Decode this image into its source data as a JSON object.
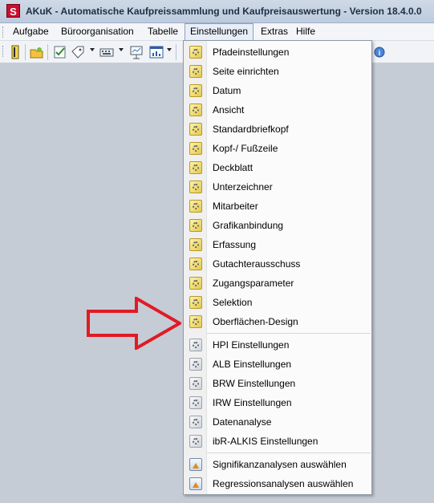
{
  "window": {
    "app_icon_letter": "S",
    "title": "AKuK - Automatische Kaufpreissammlung und Kaufpreisauswertung - Version 18.4.0.0"
  },
  "menubar": {
    "items": [
      {
        "label": "Aufgabe",
        "mnemonic": "A"
      },
      {
        "label": "Büroorganisation",
        "mnemonic": "B"
      },
      {
        "label": "Tabelle",
        "mnemonic": "T"
      },
      {
        "label": "Einstellungen",
        "mnemonic": "E",
        "active": true
      },
      {
        "label": "Extras",
        "mnemonic": "x"
      },
      {
        "label": "Hilfe",
        "mnemonic": "H"
      }
    ]
  },
  "toolbar": {
    "icons": [
      "book-icon",
      "open-folder-icon",
      "checklist-icon",
      "tag-icon",
      "keyboard-icon",
      "presentation-icon",
      "window-chart-icon",
      "help-icon"
    ]
  },
  "dropdown": {
    "group1": [
      "Pfadeinstellungen",
      "Seite einrichten",
      "Datum",
      "Ansicht",
      "Standardbriefkopf",
      "Kopf-/ Fußzeile",
      "Deckblatt",
      "Unterzeichner",
      "Mitarbeiter",
      "Grafikanbindung",
      "Erfassung",
      "Gutachterausschuss",
      "Zugangsparameter",
      "Selektion",
      "Oberflächen-Design"
    ],
    "group2": [
      "HPI Einstellungen",
      "ALB Einstellungen",
      "BRW Einstellungen",
      "IRW Einstellungen",
      "Datenanalyse",
      "ibR-ALKIS Einstellungen"
    ],
    "group3": [
      "Signifikanzanalysen auswählen",
      "Regressionsanalysen auswählen"
    ]
  },
  "colors": {
    "workspace": "#c6ccd6",
    "arrow": "#e01b24",
    "menu_highlight": "#e8eef7"
  }
}
